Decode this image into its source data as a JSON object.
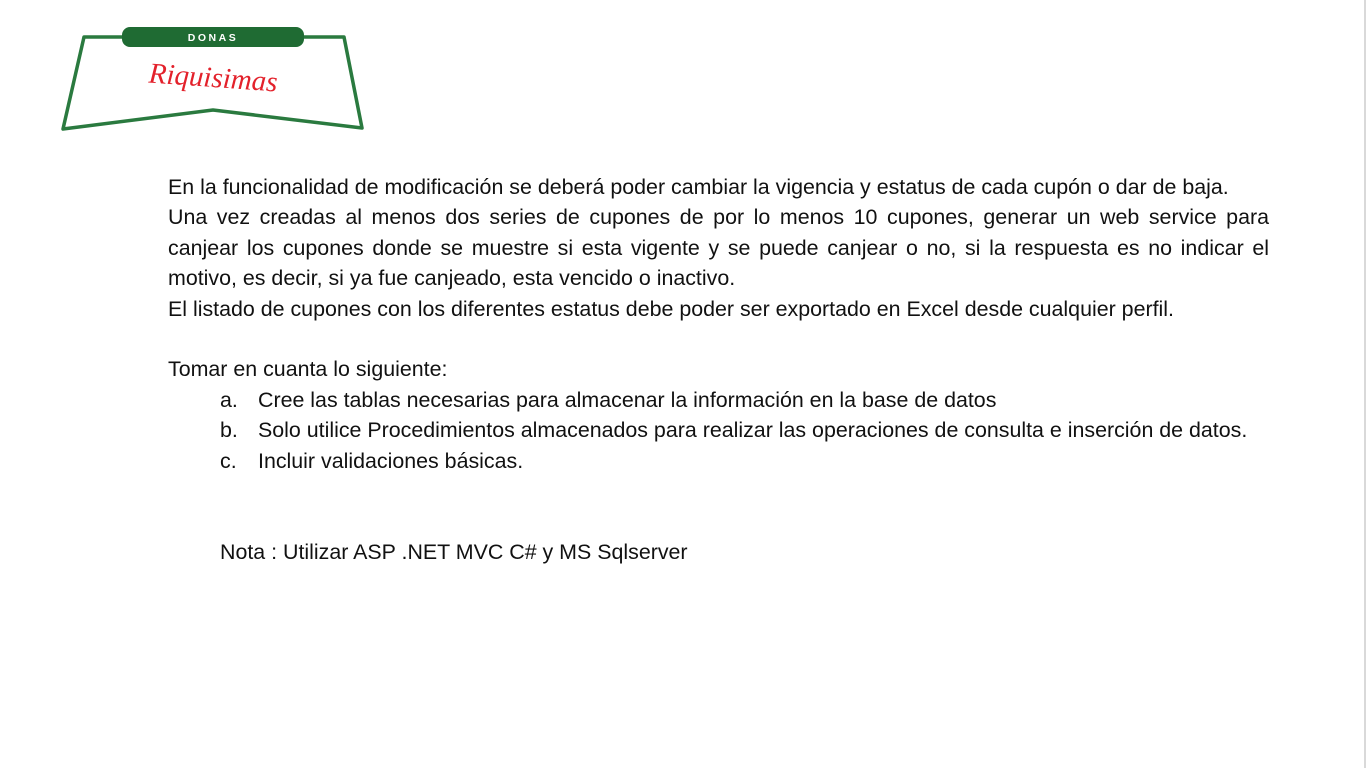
{
  "logo": {
    "top_text": "DONAS",
    "script_text": "Riquisimas",
    "green_color": "#2a7a3f",
    "band_color": "#1f6b33",
    "script_color": "#e3212b"
  },
  "paragraphs": {
    "p1": "En la funcionalidad de modificación se deberá poder cambiar la vigencia y estatus de cada cupón o dar de baja.",
    "p2": "Una vez creadas al menos dos series de cupones de por lo menos 10 cupones, generar un web service para canjear los cupones donde se muestre si esta vigente y se puede canjear o no, si la respuesta es no indicar el motivo, es decir, si ya fue canjeado, esta vencido o inactivo.",
    "p3": "El listado de cupones con los diferentes estatus debe poder ser exportado en Excel desde cualquier perfil.",
    "intro": "Tomar en cuanta lo siguiente:"
  },
  "requirements": [
    {
      "marker": "a.",
      "text": "Cree las tablas necesarias para almacenar la información en la base de datos"
    },
    {
      "marker": "b.",
      "text": "Solo utilice Procedimientos almacenados para realizar las operaciones de consulta e inserción de datos."
    },
    {
      "marker": "c.",
      "text": "Incluir validaciones básicas."
    }
  ],
  "note": "Nota : Utilizar ASP .NET MVC C#  y MS Sqlserver"
}
